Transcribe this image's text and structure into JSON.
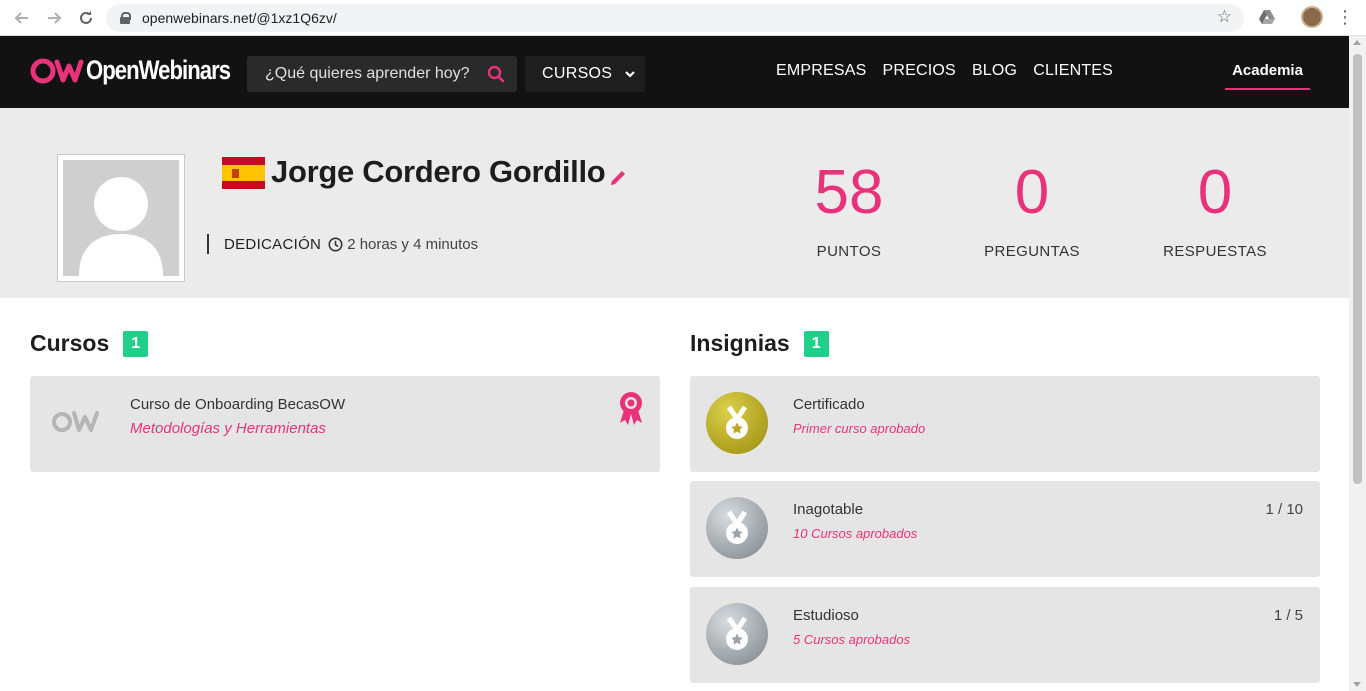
{
  "browser": {
    "url": "openwebinars.net/@1xz1Q6zv/"
  },
  "site_nav": {
    "logo_text": "OpenWebinars",
    "search_placeholder": "¿Qué quieres aprender hoy?",
    "cursos_label": "CURSOS",
    "links": [
      "EMPRESAS",
      "PRECIOS",
      "BLOG",
      "CLIENTES"
    ],
    "academia_label": "Academia"
  },
  "profile": {
    "name": "Jorge Cordero Gordillo",
    "dedication_label": "DEDICACIÓN",
    "dedication_hours": "2",
    "dedication_hours_unit": "horas y",
    "dedication_minutes": "4",
    "dedication_minutes_unit": "minutos",
    "stats": [
      {
        "value": "58",
        "label": "PUNTOS"
      },
      {
        "value": "0",
        "label": "PREGUNTAS"
      },
      {
        "value": "0",
        "label": "RESPUESTAS"
      }
    ]
  },
  "courses": {
    "title": "Cursos",
    "count": "1",
    "items": [
      {
        "name": "Curso de Onboarding BecasOW",
        "category": "Metodologías y Herramientas"
      }
    ]
  },
  "badges": {
    "title": "Insignias",
    "count": "1",
    "items": [
      {
        "name": "Certificado",
        "description": "Primer curso aprobado",
        "progress": "",
        "medal": "gold"
      },
      {
        "name": "Inagotable",
        "description": "10 Cursos aprobados",
        "progress": "1 / 10",
        "medal": "silver"
      },
      {
        "name": "Estudioso",
        "description": "5 Cursos aprobados",
        "progress": "1 / 5",
        "medal": "silver"
      }
    ]
  },
  "colors": {
    "accent": "#e8337a",
    "badge_count": "#1fcf8a",
    "nav_bg": "#121212",
    "header_bg": "#ebebeb"
  }
}
